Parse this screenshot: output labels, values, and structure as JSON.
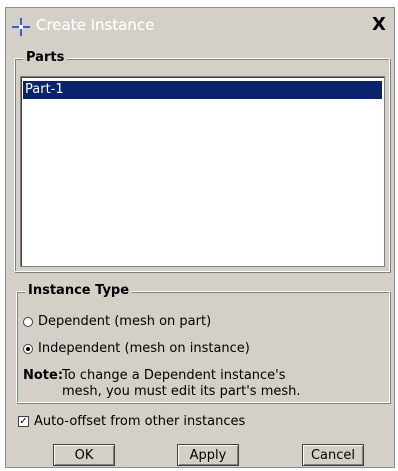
{
  "window": {
    "title": "Create Instance",
    "close_label": "X",
    "icon": "abaqus-cross-icon"
  },
  "parts": {
    "legend": "Parts",
    "items": [
      "Part-1"
    ],
    "selected": "Part-1"
  },
  "instance_type": {
    "legend": "Instance Type",
    "options": [
      {
        "label": "Dependent (mesh on part)",
        "selected": false
      },
      {
        "label": "Independent (mesh on instance)",
        "selected": true
      }
    ],
    "note_label": "Note:",
    "note_line1": "To change a Dependent instance's",
    "note_line2": "mesh, you must edit its part's mesh."
  },
  "auto_offset": {
    "label": "Auto-offset from other instances",
    "checked": true
  },
  "buttons": {
    "ok": "OK",
    "apply": "Apply",
    "cancel": "Cancel"
  },
  "colors": {
    "selection": "#0a246a",
    "dialog_bg": "#d4d0c8"
  }
}
